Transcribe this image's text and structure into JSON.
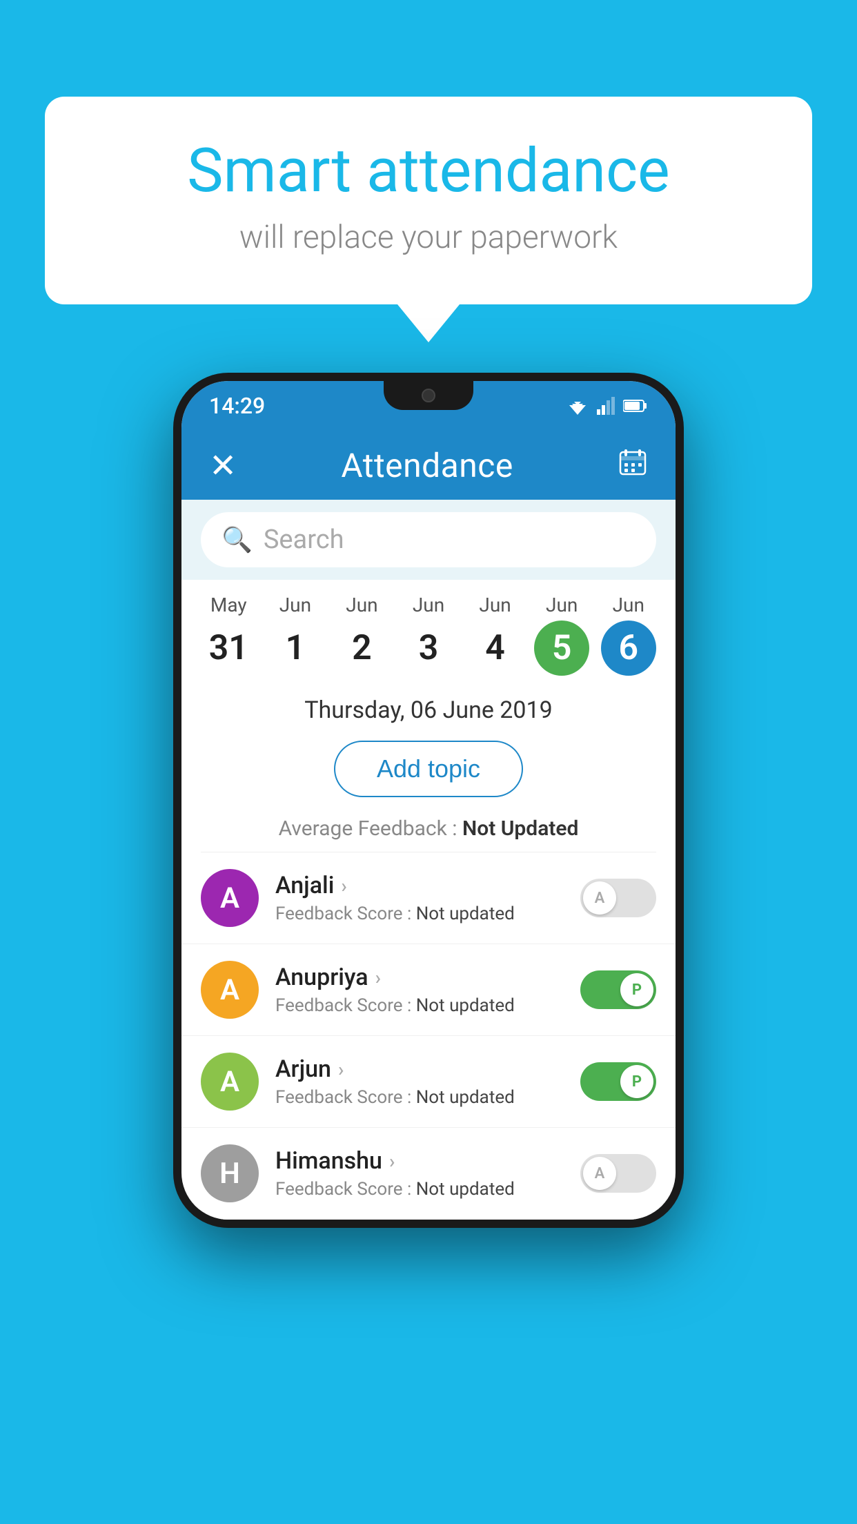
{
  "bubble": {
    "title": "Smart attendance",
    "subtitle": "will replace your paperwork"
  },
  "statusBar": {
    "time": "14:29"
  },
  "appBar": {
    "title": "Attendance",
    "closeLabel": "✕"
  },
  "search": {
    "placeholder": "Search"
  },
  "calendar": {
    "days": [
      {
        "month": "May",
        "date": "31",
        "state": "normal"
      },
      {
        "month": "Jun",
        "date": "1",
        "state": "normal"
      },
      {
        "month": "Jun",
        "date": "2",
        "state": "normal"
      },
      {
        "month": "Jun",
        "date": "3",
        "state": "normal"
      },
      {
        "month": "Jun",
        "date": "4",
        "state": "normal"
      },
      {
        "month": "Jun",
        "date": "5",
        "state": "today"
      },
      {
        "month": "Jun",
        "date": "6",
        "state": "selected"
      }
    ],
    "selectedDate": "Thursday, 06 June 2019"
  },
  "addTopicButton": "Add topic",
  "feedbackSummary": {
    "label": "Average Feedback :",
    "value": "Not Updated"
  },
  "students": [
    {
      "name": "Anjali",
      "initial": "A",
      "avatarColor": "#9c27b0",
      "feedbackLabel": "Feedback Score :",
      "feedbackValue": "Not updated",
      "toggleState": "off",
      "toggleLabel": "A"
    },
    {
      "name": "Anupriya",
      "initial": "A",
      "avatarColor": "#f5a623",
      "feedbackLabel": "Feedback Score :",
      "feedbackValue": "Not updated",
      "toggleState": "on",
      "toggleLabel": "P"
    },
    {
      "name": "Arjun",
      "initial": "A",
      "avatarColor": "#8bc34a",
      "feedbackLabel": "Feedback Score :",
      "feedbackValue": "Not updated",
      "toggleState": "on",
      "toggleLabel": "P"
    },
    {
      "name": "Himanshu",
      "initial": "H",
      "avatarColor": "#9e9e9e",
      "feedbackLabel": "Feedback Score :",
      "feedbackValue": "Not updated",
      "toggleState": "off",
      "toggleLabel": "A"
    }
  ]
}
